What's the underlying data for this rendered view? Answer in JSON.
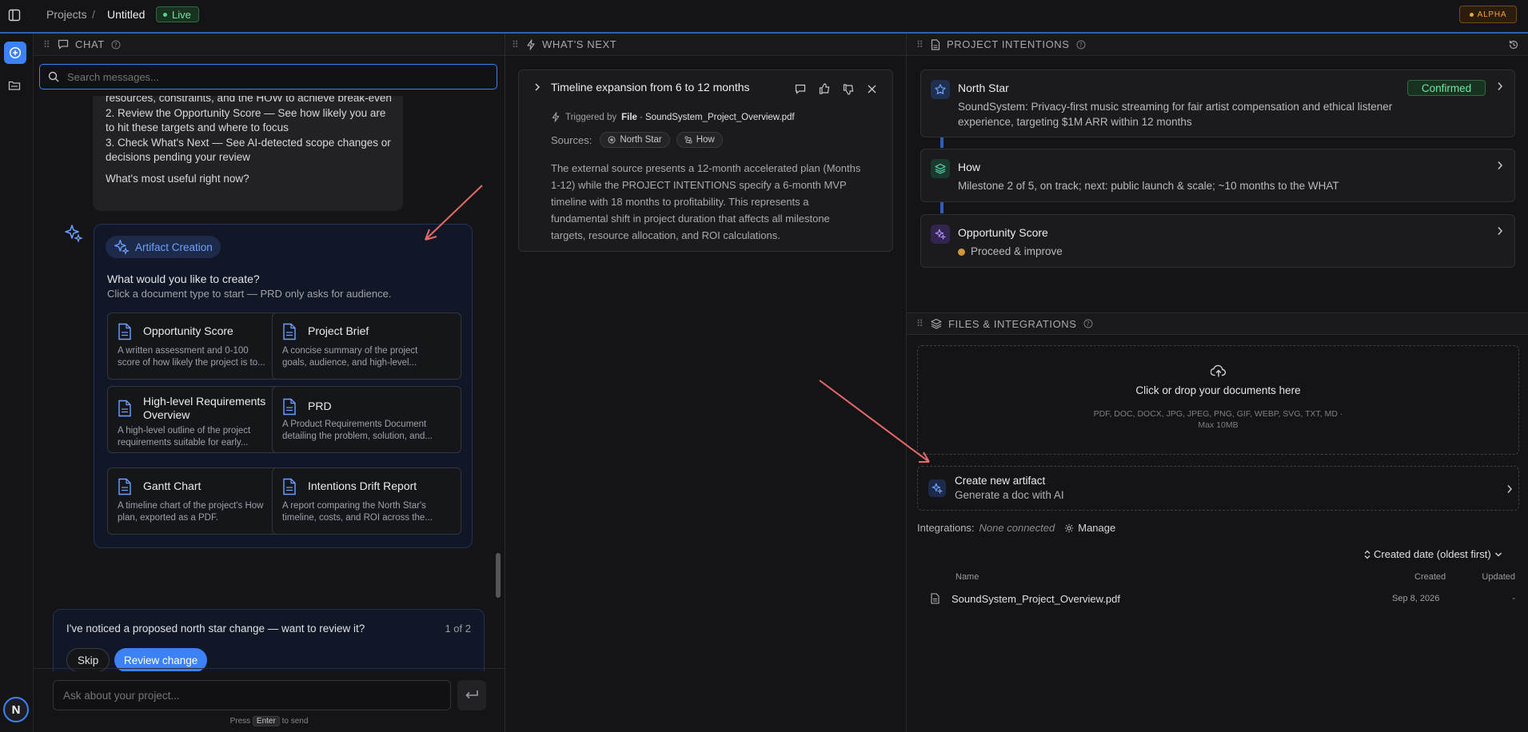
{
  "topbar": {
    "breadcrumb_root": "Projects",
    "breadcrumb_sep": "/",
    "breadcrumb_current": "Untitled",
    "live_label": "Live",
    "alpha_label": "ALPHA"
  },
  "chat": {
    "header": "CHAT",
    "search_placeholder": "Search messages...",
    "msg_cut": "resources, constraints, and the HOW to achieve break-even",
    "msg_line2a": "2. Review the Opportunity Score — See how likely you are",
    "msg_line2b": "to hit these targets and where to focus",
    "msg_line3a": "3. Check What's Next — See AI-detected scope changes or",
    "msg_line3b": "decisions pending your review",
    "msg_question": "What's most useful right now?",
    "artifact_badge": "Artifact Creation",
    "artifact_q": "What would you like to create?",
    "artifact_hint": "Click a document type to start — PRD only asks for audience.",
    "docs": [
      {
        "title": "Opportunity Score",
        "desc1": "A written assessment and 0-100",
        "desc2": "score of how likely the project is to..."
      },
      {
        "title": "Project Brief",
        "desc1": "A concise summary of the project",
        "desc2": "goals, audience, and high-level..."
      },
      {
        "title": "High-level Requirements",
        "title2": "Overview",
        "desc1": "A high-level outline of the project",
        "desc2": "requirements suitable for early..."
      },
      {
        "title": "PRD",
        "desc1": "A Product Requirements Document",
        "desc2": "detailing the problem, solution, and..."
      },
      {
        "title": "Gantt Chart",
        "desc1": "A timeline chart of the project's How",
        "desc2": "plan, exported as a PDF."
      },
      {
        "title": "Intentions Drift Report",
        "desc1": "A report comparing the North Star's",
        "desc2": "timeline, costs, and ROI across the..."
      }
    ],
    "notice_text": "I've noticed a proposed north star change — want to review it?",
    "notice_count": "1 of 2",
    "skip_label": "Skip",
    "review_label": "Review change",
    "input_placeholder": "Ask about your project...",
    "press": "Press",
    "enter_key": "Enter",
    "to_send": "to send",
    "avatar_letter": "N"
  },
  "whats_next": {
    "header": "WHAT'S NEXT",
    "card_title": "Timeline expansion from 6 to 12 months",
    "triggered_by": "Triggered by",
    "trigger_type": "File",
    "trigger_file": "· SoundSystem_Project_Overview.pdf",
    "sources_label": "Sources:",
    "source1": "North Star",
    "source2": "How",
    "body1": "The external source presents a 12-month accelerated plan (Months",
    "body2": "1-12) while the PROJECT INTENTIONS specify a 6-month MVP",
    "body3": "timeline with 18 months to profitability. This represents a",
    "body4": "fundamental shift in project duration that affects all milestone",
    "body5": "targets, resource allocation, and ROI calculations."
  },
  "intentions": {
    "header": "PROJECT INTENTIONS",
    "north_star_title": "North Star",
    "north_star_status": "Confirmed",
    "north_star_text1": "SoundSystem: Privacy-first music streaming for fair artist compensation and ethical listener",
    "north_star_text2": "experience, targeting $1M ARR within 12 months",
    "how_title": "How",
    "how_text": "Milestone 2 of 5, on track; next: public launch & scale; ~10 months to the WHAT",
    "opp_title": "Opportunity Score",
    "opp_text": "Proceed & improve"
  },
  "files": {
    "header": "FILES & INTEGRATIONS",
    "drop_title": "Click or drop your documents here",
    "drop_types": "PDF, DOC, DOCX, JPG, JPEG, PNG, GIF, WEBP, SVG, TXT, MD ·",
    "drop_max": "Max 10MB",
    "create_title": "Create new artifact",
    "create_sub": "Generate a doc with AI",
    "integrations_label": "Integrations:",
    "integrations_value": "None connected",
    "manage_label": "Manage",
    "sort_label": "Created date (oldest first)",
    "col_name": "Name",
    "col_created": "Created",
    "col_updated": "Updated",
    "file_name": "SoundSystem_Project_Overview.pdf",
    "file_created": "Sep 8, 2026",
    "file_updated": "-"
  },
  "colors": {
    "accent": "#3b82f6",
    "live_green": "#4ade80",
    "confirmed_green": "#6ee7a0",
    "alpha_orange": "#f2a23a",
    "annotation_arrow": "#e86a6a"
  }
}
